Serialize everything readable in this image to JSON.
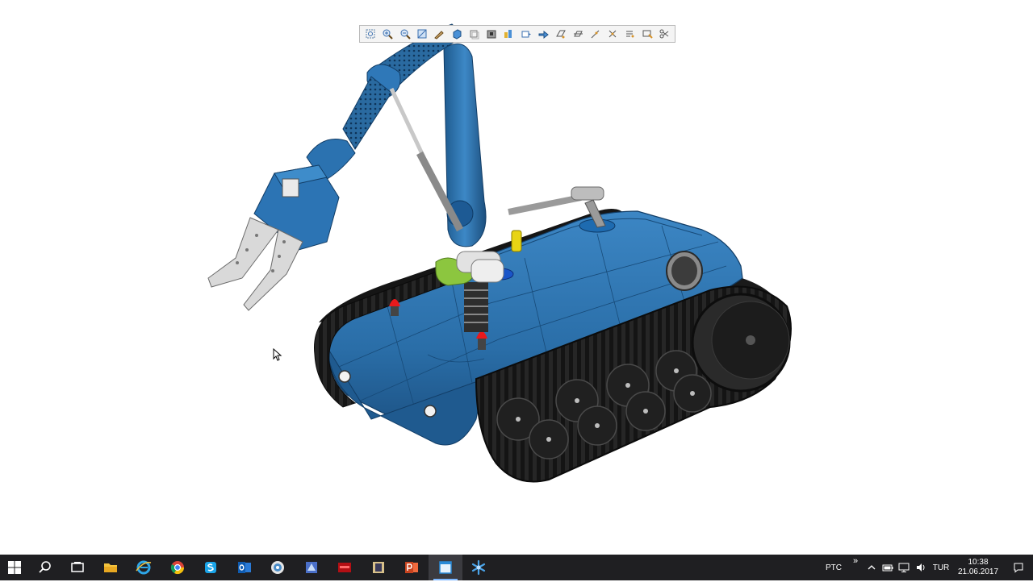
{
  "viewport": {
    "background": "#ffffff",
    "model": "tracked robot with manipulator arm"
  },
  "toolbar": {
    "buttons": [
      {
        "icon": "zoom-window-icon"
      },
      {
        "icon": "zoom-in-icon"
      },
      {
        "icon": "zoom-out-icon"
      },
      {
        "icon": "fit-view-icon"
      },
      {
        "icon": "orient-icon"
      },
      {
        "icon": "shaded-icon"
      },
      {
        "icon": "wireframe-icon"
      },
      {
        "icon": "saved-views-icon"
      },
      {
        "icon": "datum-display-icon"
      },
      {
        "icon": "view-manager-icon"
      },
      {
        "icon": "spin-center-icon"
      },
      {
        "icon": "plane-display-icon"
      },
      {
        "icon": "axis-display-icon"
      },
      {
        "icon": "point-display-icon"
      },
      {
        "icon": "csys-display-icon"
      },
      {
        "icon": "annotation-display-icon"
      },
      {
        "icon": "appearance-icon"
      },
      {
        "icon": "regenerate-icon"
      }
    ]
  },
  "taskbar": {
    "apps": [
      {
        "name": "search",
        "icon": "search-icon"
      },
      {
        "name": "task-view",
        "icon": "task-view-icon"
      },
      {
        "name": "file-explorer",
        "icon": "folder-icon"
      },
      {
        "name": "internet-explorer",
        "icon": "ie-icon"
      },
      {
        "name": "chrome",
        "icon": "chrome-icon"
      },
      {
        "name": "skype",
        "icon": "skype-icon"
      },
      {
        "name": "outlook",
        "icon": "outlook-icon"
      },
      {
        "name": "app-circle",
        "icon": "circle-app-icon"
      },
      {
        "name": "app-blue",
        "icon": "blue-app-icon"
      },
      {
        "name": "app-red",
        "icon": "red-app-icon"
      },
      {
        "name": "app-tower",
        "icon": "tower-app-icon"
      },
      {
        "name": "powerpoint",
        "icon": "powerpoint-icon"
      },
      {
        "name": "creo-window",
        "icon": "window-app-icon",
        "active": true
      },
      {
        "name": "creo",
        "icon": "creo-icon"
      }
    ],
    "tray": {
      "ptc_label": "PTC",
      "chevron": "»",
      "language": "TUR",
      "time": "10:38",
      "date": "21.06.2017"
    }
  },
  "colors": {
    "body_blue": "#2a6ea8",
    "body_dark": "#1b4f80",
    "track": "#161616",
    "lamp_red": "#e8191c",
    "lamp_yellow": "#e8d414",
    "green_part": "#8cc63f",
    "taskbar_bg": "#1f1f22"
  }
}
